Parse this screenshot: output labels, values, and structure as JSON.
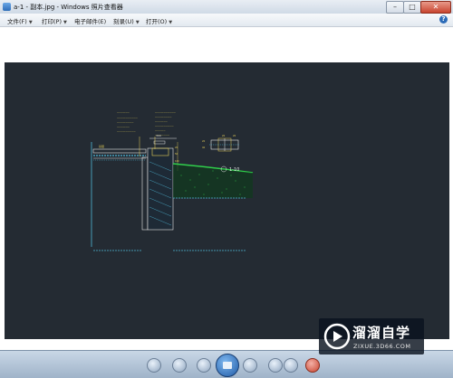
{
  "window": {
    "title": "a-1 - 副本.jpg - Windows 照片查看器",
    "minimize": "–",
    "maximize": "□",
    "close": "✕"
  },
  "menu": {
    "items": [
      {
        "label": "文件(F)"
      },
      {
        "label": "打印(P)"
      },
      {
        "label": "电子邮件(E)"
      },
      {
        "label": "刻录(U)"
      },
      {
        "label": "打开(O)"
      }
    ],
    "help": "?"
  },
  "drawing": {
    "section_label": "1-10"
  },
  "toolbar": {
    "icons": [
      "zoom-icon",
      "actual-size-icon",
      "previous-icon",
      "slideshow-icon",
      "next-icon",
      "rotate-left-icon",
      "rotate-right-icon",
      "delete-icon"
    ]
  },
  "watermark": {
    "brand": "溜溜自学",
    "url": "ZIXUE.3D66.COM"
  },
  "colors": {
    "photo_bg": "#242b33",
    "cad_yellow": "#e8d25a",
    "cad_white": "#e6e6e6",
    "cad_green": "#2fd04a",
    "cad_cyan": "#4fb8d8",
    "delete_red": "#c8442f"
  }
}
